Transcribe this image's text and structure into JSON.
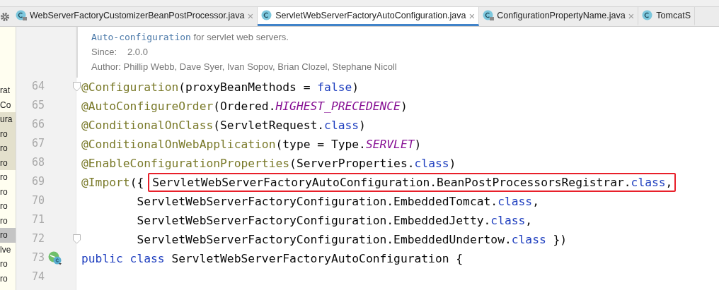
{
  "tabs": [
    {
      "label": "WebServerFactoryCustomizerBeanPostProcessor.java",
      "selected": false,
      "locked": true,
      "closable": true
    },
    {
      "label": "ServletWebServerFactoryAutoConfiguration.java",
      "selected": true,
      "locked": false,
      "closable": true
    },
    {
      "label": "ConfigurationPropertyName.java",
      "selected": false,
      "locked": true,
      "closable": true
    },
    {
      "label": "TomcatS",
      "selected": false,
      "locked": false,
      "closable": false
    }
  ],
  "close_glyph": "×",
  "project_tree": [
    {
      "text": "rat",
      "selected": false,
      "shaded": false
    },
    {
      "text": "Co",
      "selected": false,
      "shaded": false
    },
    {
      "text": "ura",
      "selected": false,
      "shaded": true
    },
    {
      "text": "ro",
      "selected": false,
      "shaded": true
    },
    {
      "text": "ro",
      "selected": false,
      "shaded": true
    },
    {
      "text": "ro",
      "selected": false,
      "shaded": true
    },
    {
      "text": "ro",
      "selected": false,
      "shaded": false
    },
    {
      "text": "ro",
      "selected": false,
      "shaded": false
    },
    {
      "text": "ro",
      "selected": false,
      "shaded": false
    },
    {
      "text": "ro",
      "selected": false,
      "shaded": false
    },
    {
      "text": "ro",
      "selected": true,
      "shaded": false
    },
    {
      "text": "lve",
      "selected": false,
      "shaded": false
    },
    {
      "text": "ro",
      "selected": false,
      "shaded": false
    },
    {
      "text": "ro",
      "selected": false,
      "shaded": false
    }
  ],
  "doc": {
    "summary_code": "Auto-configuration",
    "summary_rest": " for servlet web servers.",
    "since_label": "Since:",
    "since": "2.0.0",
    "author_label": "Author:",
    "authors": "Phillip Webb, Dave Syer, Ivan Sopov, Brian Clozel, Stephane Nicoll"
  },
  "lines": [
    {
      "number": "64",
      "fold_marker": true,
      "gutter_icon": false,
      "tokens": [
        {
          "t": "@Configuration",
          "kind": "annotation"
        },
        {
          "t": "(proxyBeanMethods = ",
          "kind": "plain"
        },
        {
          "t": "false",
          "kind": "keyword"
        },
        {
          "t": ")",
          "kind": "plain"
        }
      ]
    },
    {
      "number": "65",
      "fold_marker": false,
      "gutter_icon": false,
      "tokens": [
        {
          "t": "@AutoConfigureOrder",
          "kind": "annotation"
        },
        {
          "t": "(Ordered.",
          "kind": "plain"
        },
        {
          "t": "HIGHEST_PRECEDENCE",
          "kind": "constant"
        },
        {
          "t": ")",
          "kind": "plain"
        }
      ]
    },
    {
      "number": "66",
      "fold_marker": false,
      "gutter_icon": false,
      "tokens": [
        {
          "t": "@ConditionalOnClass",
          "kind": "annotation"
        },
        {
          "t": "(ServletRequest.",
          "kind": "plain"
        },
        {
          "t": "class",
          "kind": "keyword"
        },
        {
          "t": ")",
          "kind": "plain"
        }
      ]
    },
    {
      "number": "67",
      "fold_marker": false,
      "gutter_icon": false,
      "tokens": [
        {
          "t": "@ConditionalOnWebApplication",
          "kind": "annotation"
        },
        {
          "t": "(type = Type.",
          "kind": "plain"
        },
        {
          "t": "SERVLET",
          "kind": "constant"
        },
        {
          "t": ")",
          "kind": "plain"
        }
      ]
    },
    {
      "number": "68",
      "fold_marker": false,
      "gutter_icon": false,
      "tokens": [
        {
          "t": "@EnableConfigurationProperties",
          "kind": "annotation"
        },
        {
          "t": "(ServerProperties.",
          "kind": "plain"
        },
        {
          "t": "class",
          "kind": "keyword"
        },
        {
          "t": ")",
          "kind": "plain"
        }
      ]
    },
    {
      "number": "69",
      "fold_marker": false,
      "gutter_icon": false,
      "tokens": [
        {
          "t": "@Import",
          "kind": "annotation"
        },
        {
          "t": "({",
          "kind": "plain"
        }
      ],
      "boxed": [
        {
          "t": "ServletWebServerFactoryAutoConfiguration.BeanPostProcessorsRegistrar.",
          "kind": "plain"
        },
        {
          "t": "class",
          "kind": "keyword"
        },
        {
          "t": ",",
          "kind": "plain"
        }
      ]
    },
    {
      "number": "70",
      "fold_marker": false,
      "gutter_icon": false,
      "tokens": [
        {
          "t": "        ServletWebServerFactoryConfiguration.EmbeddedTomcat.",
          "kind": "plain"
        },
        {
          "t": "class",
          "kind": "keyword"
        },
        {
          "t": ",",
          "kind": "plain"
        }
      ]
    },
    {
      "number": "71",
      "fold_marker": false,
      "gutter_icon": false,
      "tokens": [
        {
          "t": "        ServletWebServerFactoryConfiguration.EmbeddedJetty.",
          "kind": "plain"
        },
        {
          "t": "class",
          "kind": "keyword"
        },
        {
          "t": ",",
          "kind": "plain"
        }
      ]
    },
    {
      "number": "72",
      "fold_marker": true,
      "gutter_icon": false,
      "tokens": [
        {
          "t": "        ServletWebServerFactoryConfiguration.EmbeddedUndertow.",
          "kind": "plain"
        },
        {
          "t": "class",
          "kind": "keyword"
        },
        {
          "t": " })",
          "kind": "plain"
        }
      ]
    },
    {
      "number": "73",
      "fold_marker": false,
      "gutter_icon": true,
      "tokens": [
        {
          "t": "public class",
          "kind": "keyword"
        },
        {
          "t": " ServletWebServerFactoryAutoConfiguration {",
          "kind": "plain"
        }
      ]
    },
    {
      "number": "74",
      "fold_marker": false,
      "gutter_icon": false
    }
  ]
}
